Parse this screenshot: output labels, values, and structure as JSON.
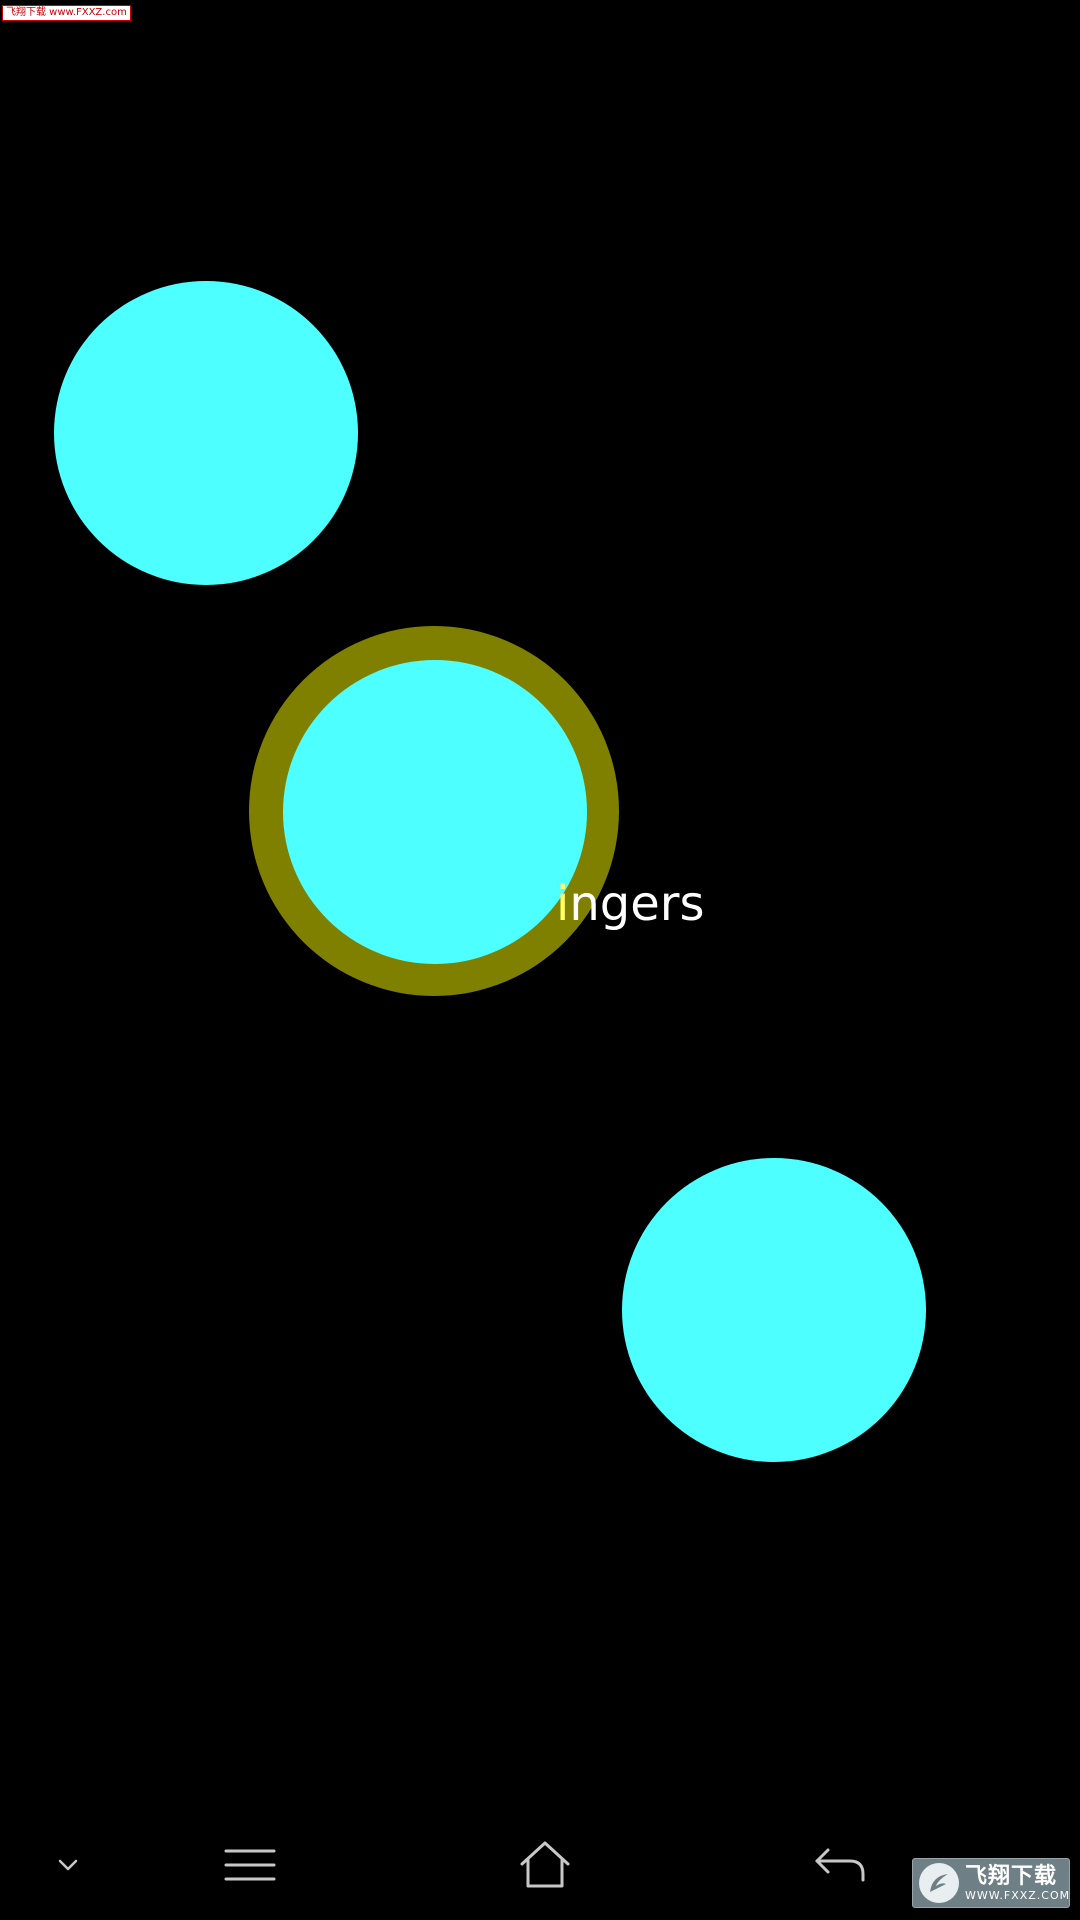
{
  "watermark_top": "飞翔下载 www.FXXZ.com",
  "prompt": {
    "highlight": "i",
    "rest": "ngers"
  },
  "colors": {
    "touch_fill": "#4dffff",
    "active_ring": "#808000",
    "background": "#000000",
    "nav_icon": "#c8c8c8"
  },
  "navbar": {
    "collapse": "chevron-down-icon",
    "menu": "menu-icon",
    "home": "home-icon",
    "back": "back-icon"
  },
  "watermark_logo": {
    "name": "飞翔下载",
    "url": "WWW.FXXZ.COM"
  }
}
